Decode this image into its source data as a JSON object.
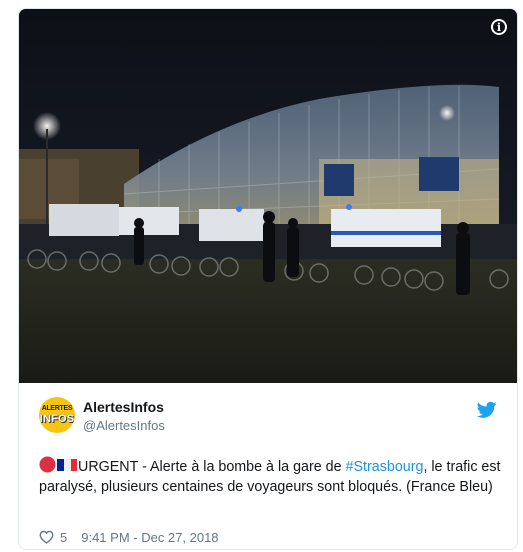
{
  "tweet": {
    "author_name": "AlertesInfos",
    "author_handle": "@AlertesInfos",
    "avatar_text_line1": "ALERTES",
    "avatar_text_line2": "INFOS",
    "text_before_hashtag": "URGENT - Alerte à la bombe à la gare de ",
    "hashtag": "#Strasbourg",
    "text_after_hashtag": ", le trafic est paralysé, plusieurs centaines de voyageurs sont bloqués. (France Bleu)",
    "like_count": "5",
    "timestamp": "9:41 PM - Dec 27, 2018",
    "info_label": "i"
  },
  "icons": {
    "info": "info-icon",
    "bird": "twitter-bird-icon",
    "heart": "heart-icon",
    "red_circle": "red-circle-emoji",
    "french_flag": "french-flag-emoji"
  },
  "colors": {
    "link": "#1b95e0",
    "text": "#14171a",
    "muted": "#657786",
    "avatar_bg": "#f7c414",
    "twitter_blue": "#1da1f2"
  }
}
